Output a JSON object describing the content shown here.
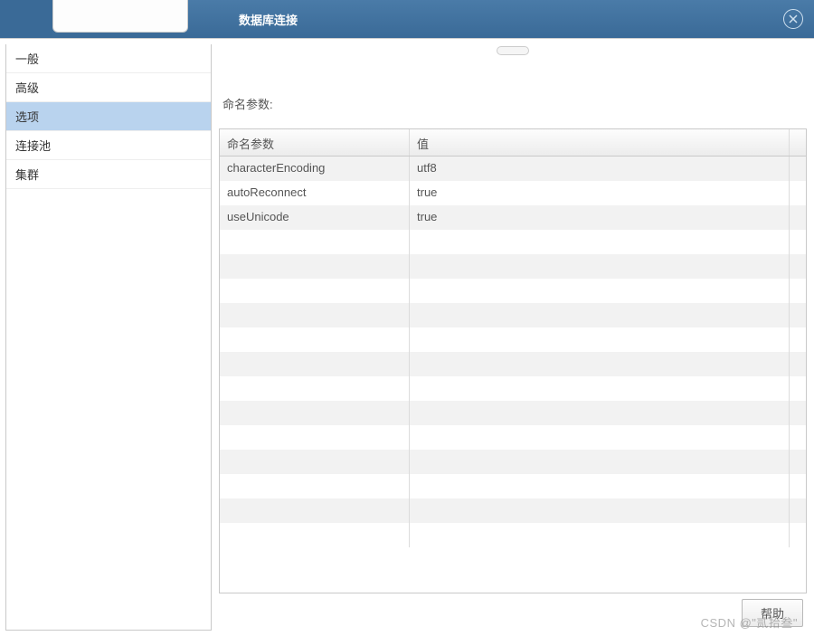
{
  "titlebar": {
    "title": "数据库连接"
  },
  "sidebar": {
    "items": [
      {
        "label": "一般",
        "selected": false
      },
      {
        "label": "高级",
        "selected": false
      },
      {
        "label": "选项",
        "selected": true
      },
      {
        "label": "连接池",
        "selected": false
      },
      {
        "label": "集群",
        "selected": false
      }
    ]
  },
  "main": {
    "section_label": "命名参数:",
    "table": {
      "headers": {
        "param": "命名参数",
        "value": "值"
      },
      "rows": [
        {
          "param": "characterEncoding",
          "value": "utf8"
        },
        {
          "param": "autoReconnect",
          "value": "true"
        },
        {
          "param": "useUnicode",
          "value": "true"
        }
      ],
      "empty_row_count": 13
    }
  },
  "footer": {
    "help_label": "帮助"
  },
  "watermark": "CSDN @\"贰拾叁\""
}
